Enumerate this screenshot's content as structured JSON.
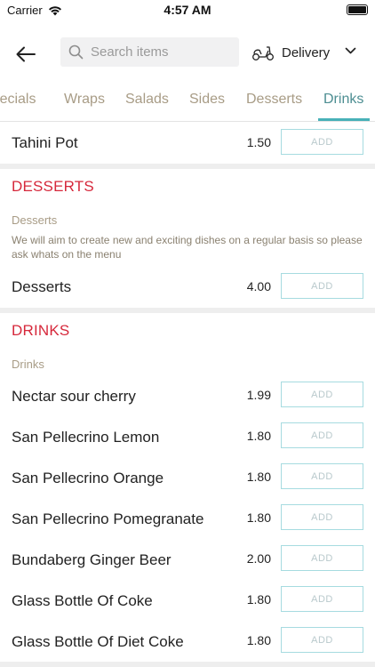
{
  "status_bar": {
    "carrier": "Carrier",
    "time": "4:57 AM"
  },
  "header": {
    "search_placeholder": "Search items",
    "delivery_label": "Delivery"
  },
  "tabs": [
    {
      "label": "Specials"
    },
    {
      "label": "Wraps"
    },
    {
      "label": "Salads"
    },
    {
      "label": "Sides"
    },
    {
      "label": "Desserts"
    },
    {
      "label": "Drinks",
      "active": true
    }
  ],
  "add_label": "ADD",
  "top_item": {
    "name": "Tahini Pot",
    "price": "1.50"
  },
  "desserts": {
    "title": "DESSERTS",
    "subtitle": "Desserts",
    "description": "We will aim to create new and exciting dishes on a regular basis so please ask whats on the menu",
    "items": [
      {
        "name": "Desserts",
        "price": "4.00"
      }
    ]
  },
  "drinks": {
    "title": "DRINKS",
    "subtitle": "Drinks",
    "items": [
      {
        "name": "Nectar sour cherry",
        "price": "1.99"
      },
      {
        "name": "San Pellecrino Lemon",
        "price": "1.80"
      },
      {
        "name": "San Pellecrino Orange",
        "price": "1.80"
      },
      {
        "name": "San Pellecrino Pomegranate",
        "price": "1.80"
      },
      {
        "name": "Bundaberg Ginger Beer",
        "price": "2.00"
      },
      {
        "name": "Glass Bottle Of Coke",
        "price": "1.80"
      },
      {
        "name": "Glass Bottle Of Diet Coke",
        "price": "1.80"
      }
    ]
  },
  "colors": {
    "accent": "#48b1b8",
    "section_title": "#d6283b",
    "tab_text": "#a89c86"
  }
}
